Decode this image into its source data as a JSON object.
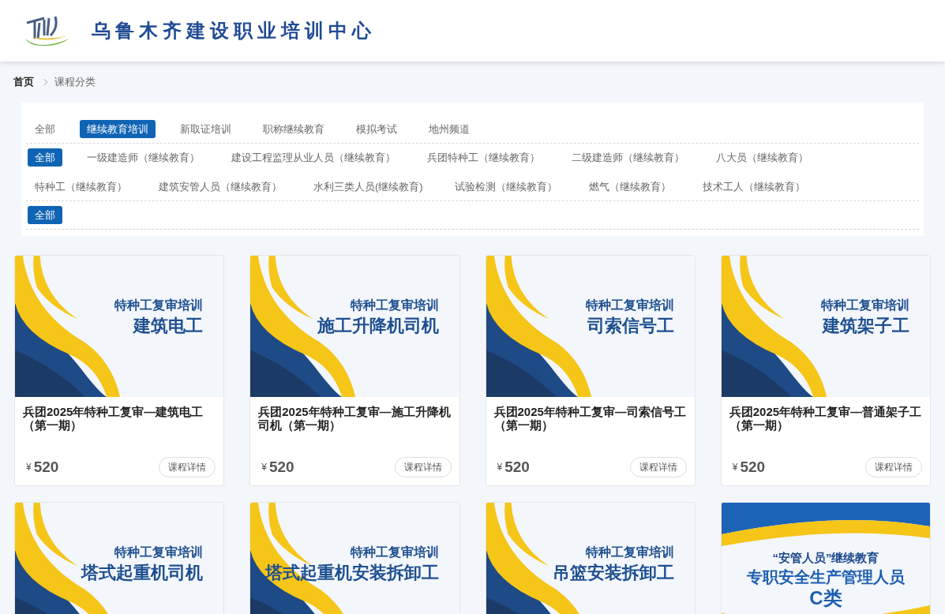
{
  "header": {
    "site_title": "乌鲁木齐建设职业培训中心"
  },
  "breadcrumb": [
    {
      "label": "首页",
      "current": false
    },
    {
      "label": "课程分类",
      "current": true
    }
  ],
  "filter_rows": [
    {
      "items": [
        {
          "label": "全部",
          "selected": false
        },
        {
          "label": "继续教育培训",
          "selected": true
        },
        {
          "label": "新取证培训",
          "selected": false
        },
        {
          "label": "职称继续教育",
          "selected": false
        },
        {
          "label": "模拟考试",
          "selected": false
        },
        {
          "label": "地州频道",
          "selected": false
        }
      ]
    },
    {
      "items": [
        {
          "label": "全部",
          "selected": true
        },
        {
          "label": "一级建造师（继续教育）",
          "selected": false
        },
        {
          "label": "建设工程监理从业人员（继续教育）",
          "selected": false
        },
        {
          "label": "兵团特种工（继续教育）",
          "selected": false
        },
        {
          "label": "二级建造师（继续教育）",
          "selected": false
        },
        {
          "label": "八大员（继续教育）",
          "selected": false
        },
        {
          "label": "特种工（继续教育）",
          "selected": false
        },
        {
          "label": "建筑安管人员（继续教育）",
          "selected": false
        },
        {
          "label": "水利三类人员(继续教育)",
          "selected": false
        },
        {
          "label": "试验检测（继续教育）",
          "selected": false
        },
        {
          "label": "燃气（继续教育）",
          "selected": false
        },
        {
          "label": "技术工人（继续教育）",
          "selected": false
        }
      ]
    },
    {
      "items": [
        {
          "label": "全部",
          "selected": true
        }
      ]
    }
  ],
  "courses": [
    {
      "thumb": {
        "kind": "swoosh",
        "lines": [
          "特种工复审培训",
          "建筑电工"
        ]
      },
      "title": "兵团2025年特种工复审—建筑电工（第一期）",
      "currency": "¥",
      "price": "520",
      "button": "课程详情"
    },
    {
      "thumb": {
        "kind": "swoosh",
        "lines": [
          "特种工复审培训",
          "施工升降机司机"
        ]
      },
      "title": "兵团2025年特种工复审—施工升降机司机（第一期）",
      "currency": "¥",
      "price": "520",
      "button": "课程详情"
    },
    {
      "thumb": {
        "kind": "swoosh",
        "lines": [
          "特种工复审培训",
          "司索信号工"
        ]
      },
      "title": "兵团2025年特种工复审—司索信号工（第一期）",
      "currency": "¥",
      "price": "520",
      "button": "课程详情"
    },
    {
      "thumb": {
        "kind": "swoosh",
        "lines": [
          "特种工复审培训",
          "建筑架子工"
        ]
      },
      "title": "兵团2025年特种工复审—普通架子工（第一期）",
      "currency": "¥",
      "price": "520",
      "button": "课程详情"
    },
    {
      "thumb": {
        "kind": "swoosh",
        "lines": [
          "特种工复审培训",
          "塔式起重机司机"
        ]
      }
    },
    {
      "thumb": {
        "kind": "swoosh",
        "lines": [
          "特种工复审培训",
          "塔式起重机安装拆卸工"
        ]
      }
    },
    {
      "thumb": {
        "kind": "swoosh",
        "lines": [
          "特种工复审培训",
          "吊篮安装拆卸工"
        ]
      }
    },
    {
      "thumb": {
        "kind": "banner",
        "lines": [
          "“安管人员”继续教育",
          "专职安全生产管理人员",
          "C类"
        ]
      }
    }
  ]
}
